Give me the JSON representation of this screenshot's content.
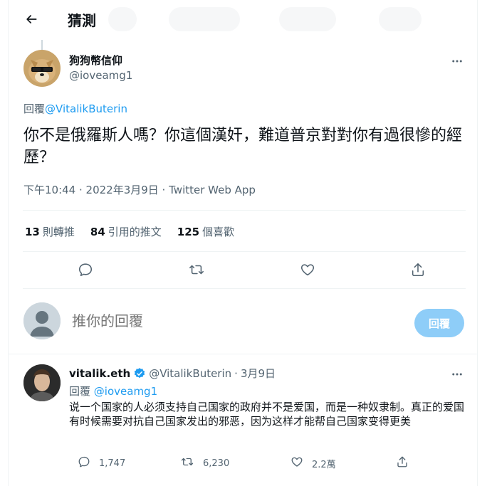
{
  "header": {
    "title": "猜測"
  },
  "tweet": {
    "author_name": "狗狗幣信仰",
    "author_handle": "@ioveamg1",
    "reply_prefix": "回覆",
    "reply_to": "@VitalikButerin",
    "text": "你不是俄羅斯人嗎？你這個漢奸，難道普京對對你有過很慘的經歷？",
    "time": "下午10:44 · 2022年3月9日 ·",
    "source": "Twitter Web App"
  },
  "stats": [
    {
      "count": "13",
      "label": "則轉推"
    },
    {
      "count": "84",
      "label": "引用的推文"
    },
    {
      "count": "125",
      "label": "個喜歡"
    }
  ],
  "composer": {
    "placeholder": "推你的回覆",
    "button_label": "回覆"
  },
  "reply": {
    "author_name": "vitalik.eth",
    "author_handle": "@VitalikButerin",
    "separator": "·",
    "date": "3月9日",
    "reply_prefix": "回覆",
    "reply_to": "@ioveamg1",
    "text": "说一个国家的人必须支持自己国家的政府并不是爱国，而是一种奴隶制。真正的爱国有时候需要对抗自己国家发出的邪恶，因为这样才能帮自己国家变得更美",
    "replies": "1,747",
    "retweets": "6,230",
    "likes": "2.2萬"
  },
  "colors": {
    "accent": "#1d9bf0",
    "muted_text": "#536471",
    "reply_button_disabled": "#8ecdf8",
    "divider": "#eff3f4"
  },
  "icons": [
    "back-arrow-icon",
    "more-icon",
    "reply-icon",
    "retweet-icon",
    "like-icon",
    "share-icon",
    "verified-badge-icon"
  ]
}
